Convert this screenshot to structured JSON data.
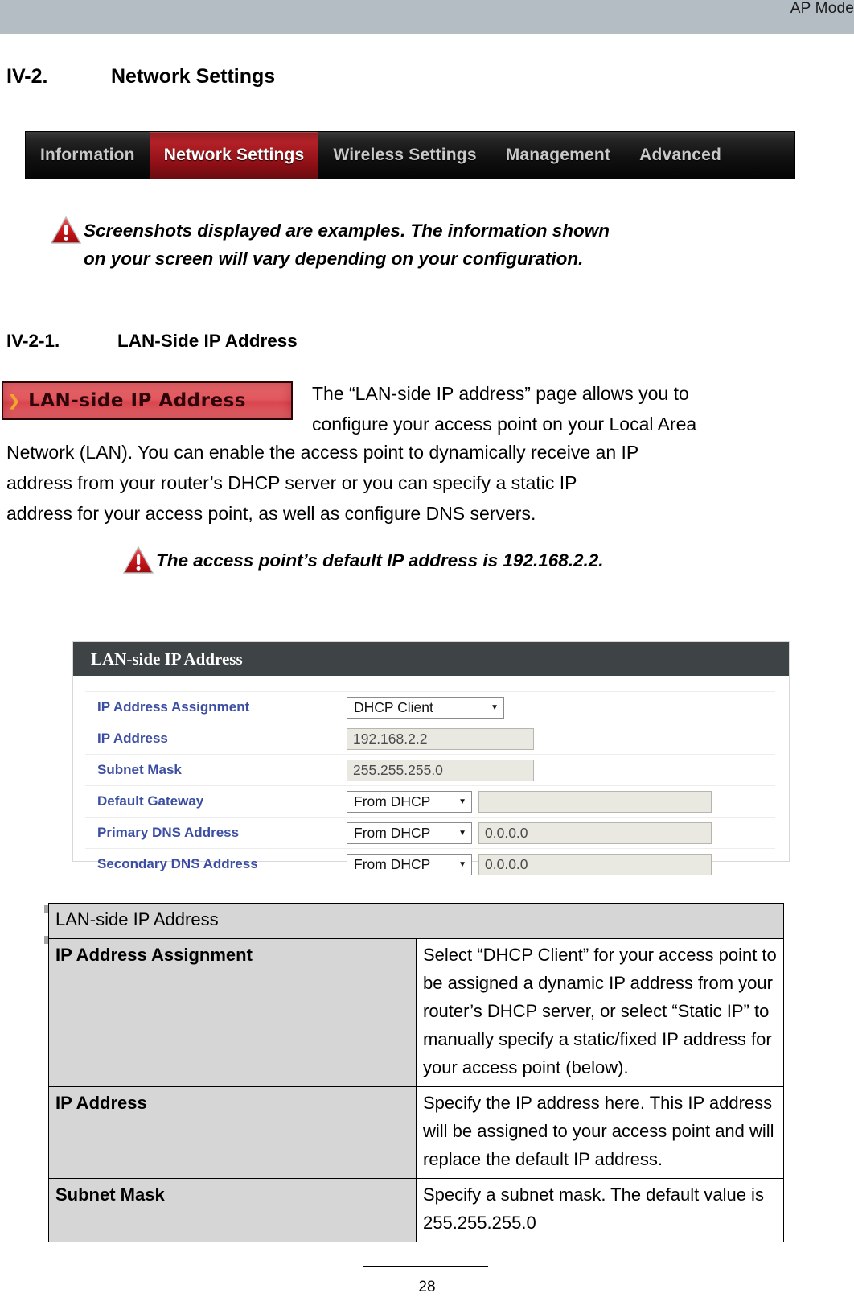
{
  "header": {
    "mode_label": "AP Mode"
  },
  "section": {
    "number": "IV-2.",
    "title": "Network Settings"
  },
  "device_nav": {
    "tabs": [
      {
        "label": "Information",
        "active": false
      },
      {
        "label": "Network Settings",
        "active": true
      },
      {
        "label": "Wireless Settings",
        "active": false
      },
      {
        "label": "Management",
        "active": false
      },
      {
        "label": "Advanced",
        "active": false
      }
    ],
    "active_color": "#b32127",
    "bar_color": "#111111"
  },
  "note_screenshots": {
    "icon": "warning-triangle-icon",
    "line1": "Screenshots displayed are examples. The information shown",
    "line2": "on your screen will vary depending on your configuration."
  },
  "subsection": {
    "number": "IV-2-1.",
    "title": "LAN-Side IP Address"
  },
  "menu_button": {
    "arrow": "❯",
    "label": "LAN-side IP Address",
    "color": "#d9454d"
  },
  "intro": {
    "right_line1": "The “LAN-side IP address” page allows you to",
    "right_line2": "configure your access point on your Local Area",
    "full_line1": "Network (LAN). You can enable the access point to dynamically receive an IP",
    "full_line2": "address  from  your  router’s  DHCP  server  or  you  can  specify  a  static  IP",
    "full_line3": "address for your access point, as well as configure DNS servers."
  },
  "note_default_ip": {
    "icon": "warning-triangle-icon",
    "text": "The access point’s default IP address is 192.168.2.2."
  },
  "panel": {
    "title": "LAN-side IP Address",
    "rows": [
      {
        "label": "IP Address Assignment",
        "control": "select",
        "select_value": "DHCP Client",
        "select_width": "wide",
        "input_value": null
      },
      {
        "label": "IP Address",
        "control": "input",
        "select_value": null,
        "input_value": "192.168.2.2"
      },
      {
        "label": "Subnet Mask",
        "control": "input",
        "select_value": null,
        "input_value": "255.255.255.0"
      },
      {
        "label": "Default Gateway",
        "control": "select+input",
        "select_value": "From DHCP",
        "select_width": "small",
        "input_value": ""
      },
      {
        "label": "Primary DNS Address",
        "control": "select+input",
        "select_value": "From DHCP",
        "select_width": "small",
        "input_value": "0.0.0.0"
      },
      {
        "label": "Secondary DNS Address",
        "control": "select+input",
        "select_value": "From DHCP",
        "select_width": "small",
        "input_value": "0.0.0.0"
      }
    ],
    "caret_glyph": "▼"
  },
  "desc_table": {
    "header": "LAN-side IP Address",
    "rows": [
      {
        "key": "IP Address Assignment",
        "value": "Select “DHCP Client” for your access point to be assigned a dynamic IP address from your router’s DHCP server, or select “Static IP” to manually specify a static/fixed IP address for your access point (below)."
      },
      {
        "key": "IP Address",
        "value": "Specify the IP address here. This IP address will be assigned to your access point and will replace the default IP address."
      },
      {
        "key": "Subnet Mask",
        "value": "Specify a subnet mask. The default value is 255.255.255.0"
      }
    ]
  },
  "footer": {
    "page_number": "28"
  }
}
